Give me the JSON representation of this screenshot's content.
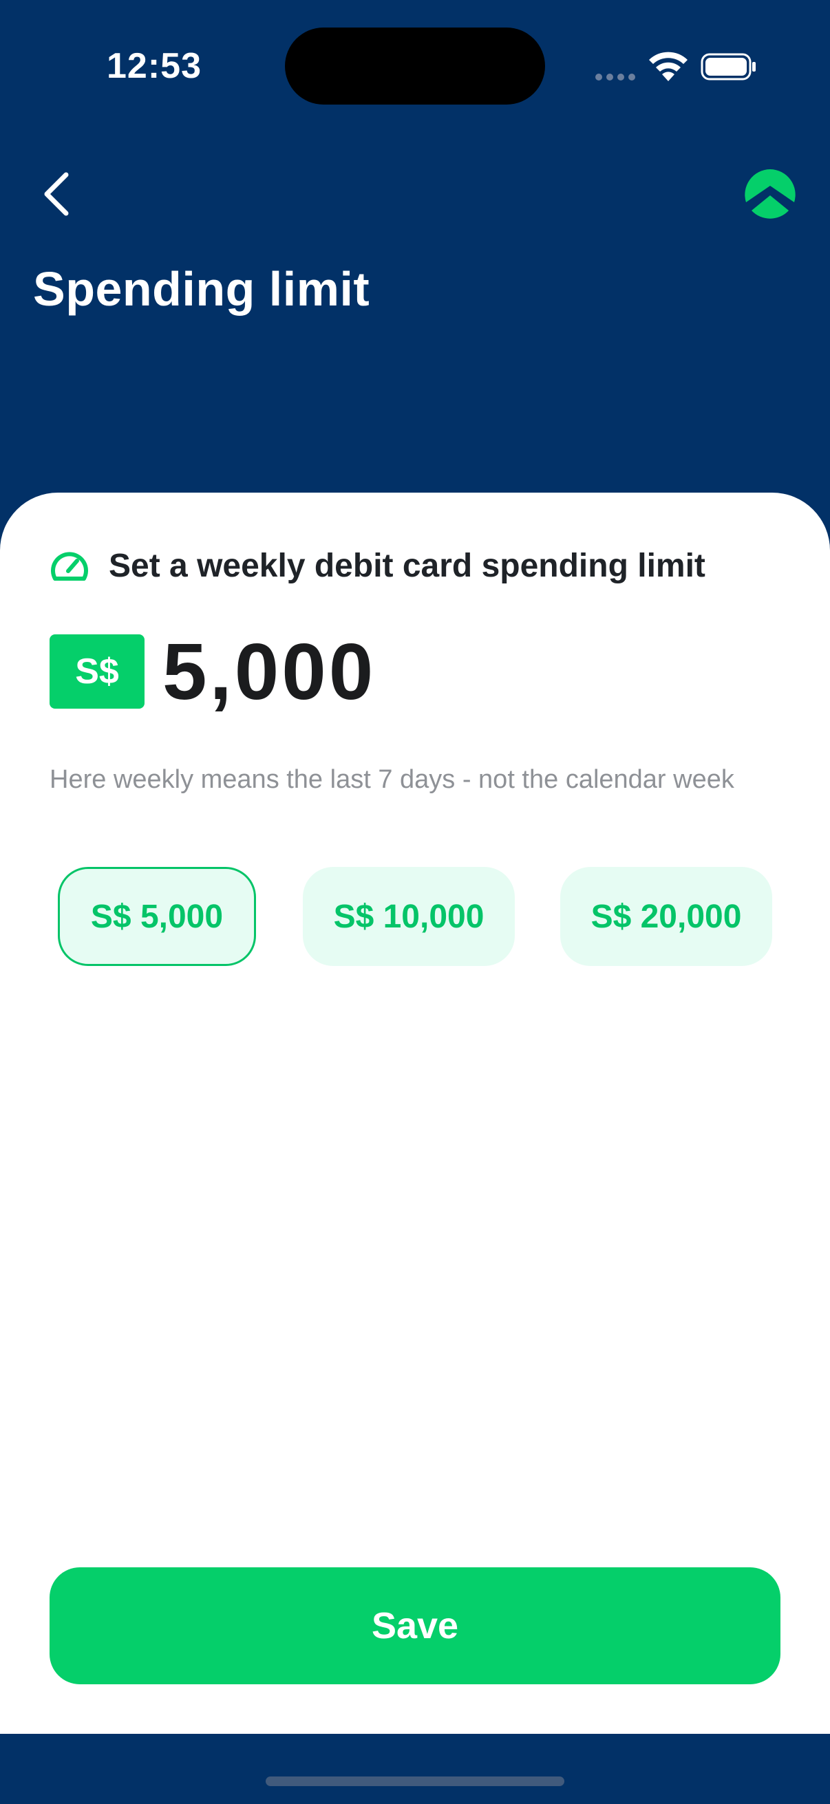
{
  "status_bar": {
    "time": "12:53"
  },
  "header": {
    "title": "Spending limit",
    "back_icon": "chevron-left-icon",
    "logo_icon": "brand-logo-icon"
  },
  "limit": {
    "section_label": "Set a weekly debit card spending limit",
    "section_icon": "speedometer-icon",
    "currency": "S$",
    "amount": "5,000",
    "helper": "Here weekly means the last 7 days - not the calendar week"
  },
  "options": [
    {
      "label": "S$ 5,000",
      "selected": true
    },
    {
      "label": "S$ 10,000",
      "selected": false
    },
    {
      "label": "S$ 20,000",
      "selected": false
    }
  ],
  "actions": {
    "save_label": "Save"
  },
  "colors": {
    "header_bg": "#023167",
    "accent_green": "#05cf6a",
    "chip_bg": "#e6fcf3",
    "text_dark": "#1b1c1e",
    "text_muted": "#8e9196"
  }
}
